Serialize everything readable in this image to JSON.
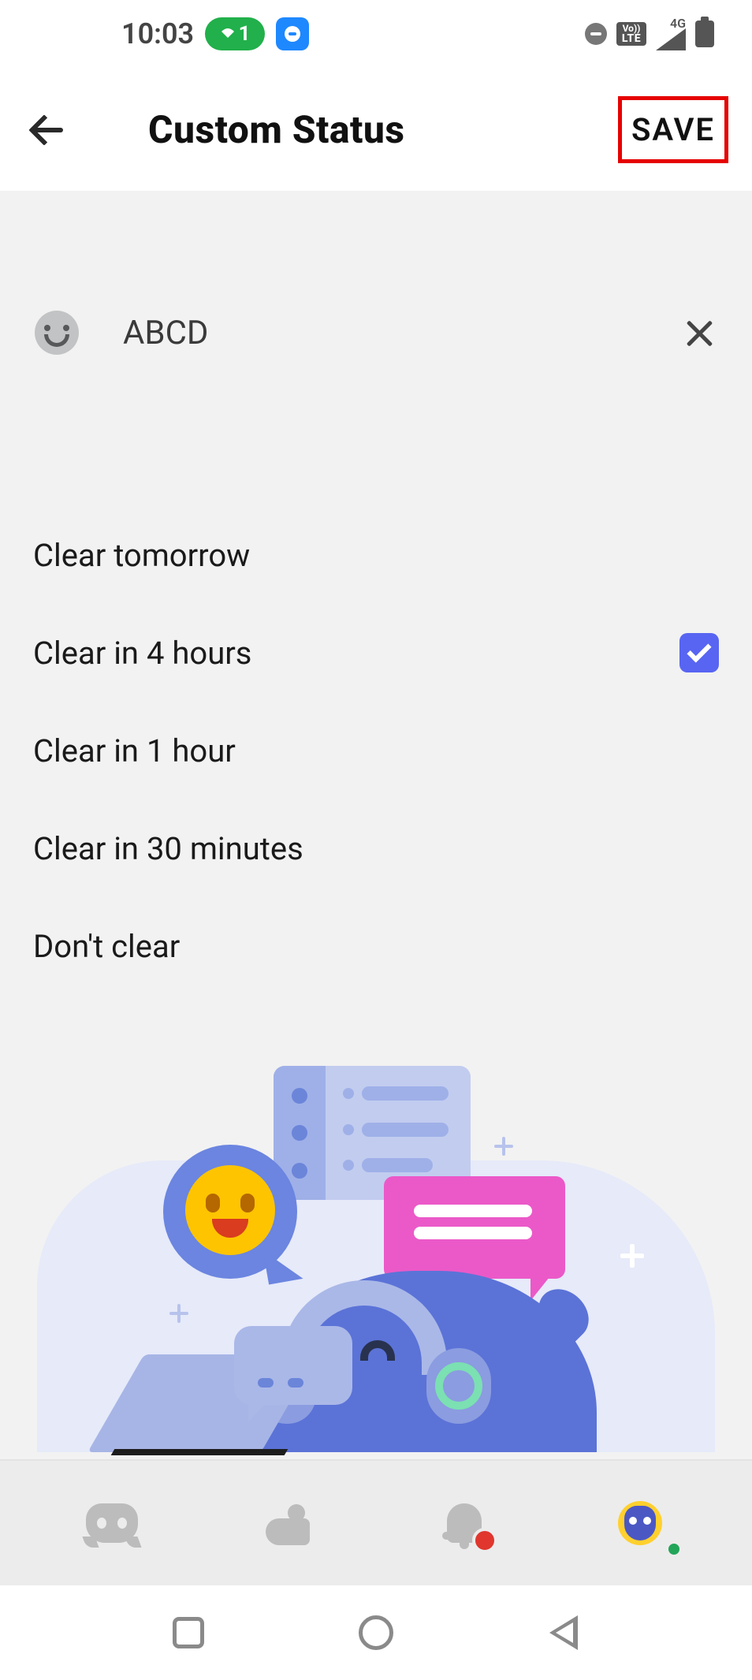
{
  "status_bar": {
    "time": "10:03",
    "wifi_notif_count": "1",
    "volte_top": "Vo))",
    "volte_bot": "LTE",
    "network_label": "4G"
  },
  "header": {
    "title": "Custom Status",
    "save_label": "SAVE"
  },
  "status_input": {
    "value": "ABCD"
  },
  "clear_options": [
    {
      "label": "Clear tomorrow",
      "selected": false
    },
    {
      "label": "Clear in 4 hours",
      "selected": true
    },
    {
      "label": "Clear in 1 hour",
      "selected": false
    },
    {
      "label": "Clear in 30 minutes",
      "selected": false
    },
    {
      "label": "Don't clear",
      "selected": false
    }
  ],
  "tabs": {
    "discord": "discord",
    "friends": "friends",
    "notifications": "notifications",
    "profile": "profile",
    "has_notification": true
  }
}
